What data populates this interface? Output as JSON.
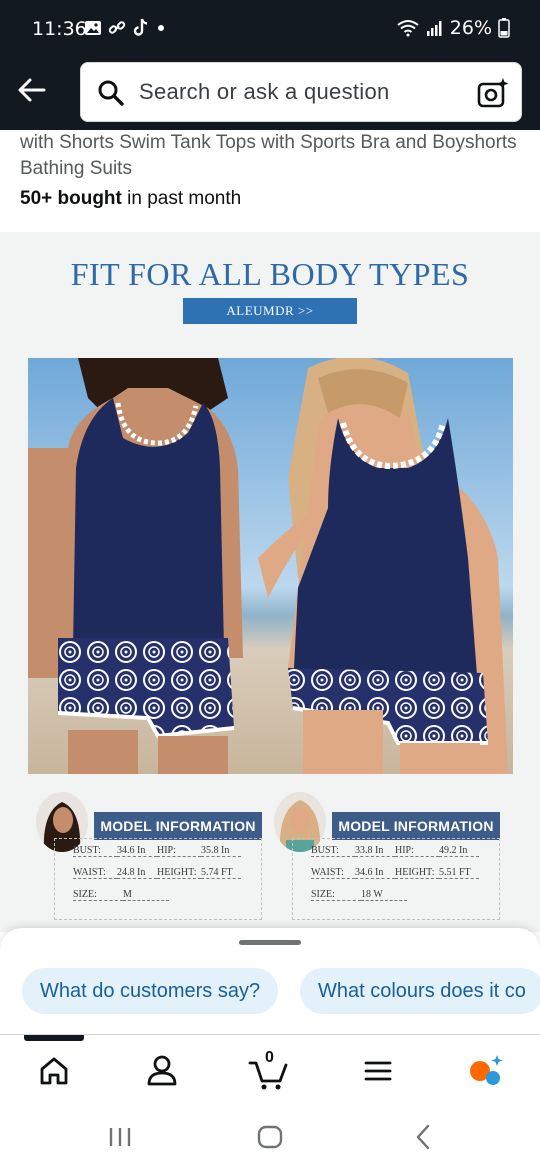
{
  "status_bar": {
    "time": "11:36",
    "battery": "26%"
  },
  "search": {
    "placeholder": "Search or ask a question"
  },
  "product": {
    "title_partial": "with Shorts Swim Tank Tops with Sports Bra and Boyshorts Bathing Suits",
    "bought_count": "50+ bought",
    "bought_suffix": " in past month"
  },
  "image": {
    "heading": "FIT FOR ALL BODY TYPES",
    "brand_button": "ALEUMDR >>",
    "models": [
      {
        "label": "MODEL INFORMATION",
        "bust_label": "BUST:",
        "bust": "34.6 In",
        "hip_label": "HIP:",
        "hip": "35.8 In",
        "waist_label": "WAIST:",
        "waist": "24.8 In",
        "height_label": "HEIGHT:",
        "height": "5.74 FT",
        "size_label": "SIZE:",
        "size": "M"
      },
      {
        "label": "MODEL INFORMATION",
        "bust_label": "BUST:",
        "bust": "33.8 In",
        "hip_label": "HIP:",
        "hip": "49.2 In",
        "waist_label": "WAIST:",
        "waist": "34.6 In",
        "height_label": "HEIGHT:",
        "height": "5.51 FT",
        "size_label": "SIZE:",
        "size": "18 W"
      }
    ]
  },
  "suggestions": [
    "What do customers say?",
    "What colours does it co"
  ],
  "bottom_nav": {
    "items": [
      "home-icon",
      "account-icon",
      "cart-icon",
      "menu-icon",
      "rufus-icon"
    ],
    "cart_count": "0"
  },
  "colors": {
    "header_bg": "#131921",
    "heading_blue": "#2e6aa8",
    "chip_bg": "#e3f1fb",
    "chip_text": "#1a5f9a",
    "model_label_bg": "#3e5c8a"
  }
}
